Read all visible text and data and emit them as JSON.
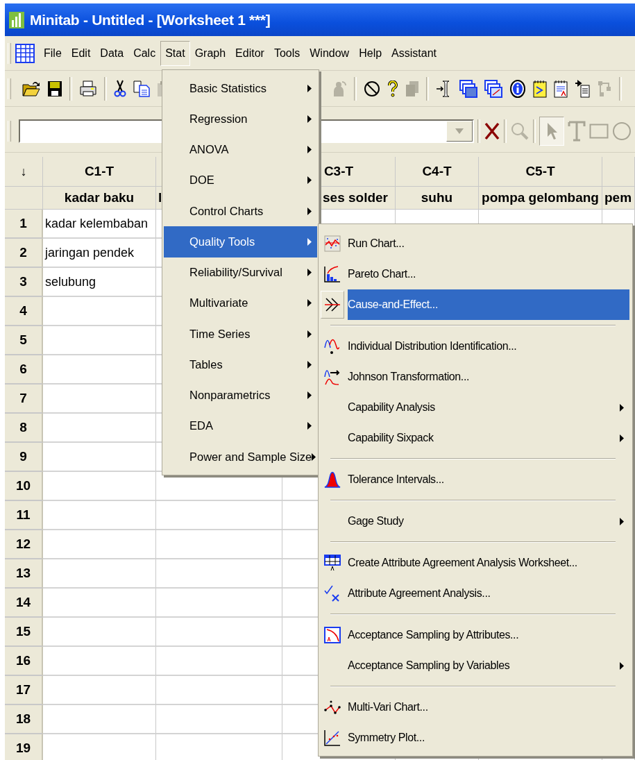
{
  "window": {
    "title": "Minitab - Untitled - [Worksheet 1 ***]"
  },
  "menubar": [
    {
      "label": "File",
      "selected": false
    },
    {
      "label": "Edit",
      "selected": false
    },
    {
      "label": "Data",
      "selected": false
    },
    {
      "label": "Calc",
      "selected": false
    },
    {
      "label": "Stat",
      "selected": true
    },
    {
      "label": "Graph",
      "selected": false
    },
    {
      "label": "Editor",
      "selected": false
    },
    {
      "label": "Tools",
      "selected": false
    },
    {
      "label": "Window",
      "selected": false
    },
    {
      "label": "Help",
      "selected": false
    },
    {
      "label": "Assistant",
      "selected": false
    }
  ],
  "worksheet": {
    "corner": "↓",
    "columns": [
      {
        "header": "C1-T",
        "name": "kadar baku"
      },
      {
        "name": "l"
      },
      {
        "header": "C3-T",
        "name": "ses solder"
      },
      {
        "header": "C4-T",
        "name": "suhu"
      },
      {
        "header": "C5-T",
        "name": "pompa gelombang"
      },
      {
        "name": "pem"
      }
    ],
    "rows": [
      {
        "number": "1",
        "cells": [
          "kadar kelembaban"
        ]
      },
      {
        "number": "2",
        "cells": [
          "jaringan pendek"
        ]
      },
      {
        "number": "3",
        "cells": [
          "selubung"
        ]
      },
      {
        "number": "4"
      },
      {
        "number": "5"
      },
      {
        "number": "6"
      },
      {
        "number": "7"
      },
      {
        "number": "8"
      },
      {
        "number": "9"
      },
      {
        "number": "10"
      },
      {
        "number": "11"
      },
      {
        "number": "12"
      },
      {
        "number": "13"
      },
      {
        "number": "14"
      },
      {
        "number": "15"
      },
      {
        "number": "16"
      },
      {
        "number": "17"
      },
      {
        "number": "18"
      },
      {
        "number": "19"
      }
    ]
  },
  "stat_menu": {
    "items": [
      {
        "label": "Basic Statistics",
        "submenu": true,
        "selected": false
      },
      {
        "label": "Regression",
        "submenu": true,
        "selected": false
      },
      {
        "label": "ANOVA",
        "submenu": true,
        "selected": false
      },
      {
        "label": "DOE",
        "submenu": true,
        "selected": false
      },
      {
        "label": "Control Charts",
        "submenu": true,
        "selected": false
      },
      {
        "label": "Quality Tools",
        "submenu": true,
        "selected": true
      },
      {
        "label": "Reliability/Survival",
        "submenu": true,
        "selected": false
      },
      {
        "label": "Multivariate",
        "submenu": true,
        "selected": false
      },
      {
        "label": "Time Series",
        "submenu": true,
        "selected": false
      },
      {
        "label": "Tables",
        "submenu": true,
        "selected": false
      },
      {
        "label": "Nonparametrics",
        "submenu": true,
        "selected": false
      },
      {
        "label": "EDA",
        "submenu": true,
        "selected": false
      },
      {
        "label": "Power and Sample Size",
        "submenu": true,
        "selected": false
      }
    ]
  },
  "quality_tools_menu": {
    "items": [
      {
        "kind": "item",
        "label": "Run Chart...",
        "submenu": false,
        "selected": false
      },
      {
        "kind": "item",
        "label": "Pareto Chart...",
        "submenu": false,
        "selected": false
      },
      {
        "kind": "item",
        "label": "Cause-and-Effect...",
        "submenu": false,
        "selected": true
      },
      {
        "kind": "separator"
      },
      {
        "kind": "item",
        "label": "Individual Distribution Identification...",
        "submenu": false,
        "selected": false
      },
      {
        "kind": "item",
        "label": "Johnson Transformation...",
        "submenu": false,
        "selected": false
      },
      {
        "kind": "item",
        "label": "Capability Analysis",
        "submenu": true,
        "selected": false
      },
      {
        "kind": "item",
        "label": "Capability Sixpack",
        "submenu": true,
        "selected": false
      },
      {
        "kind": "separator"
      },
      {
        "kind": "item",
        "label": "Tolerance Intervals...",
        "submenu": false,
        "selected": false
      },
      {
        "kind": "separator"
      },
      {
        "kind": "item",
        "label": "Gage Study",
        "submenu": true,
        "selected": false
      },
      {
        "kind": "separator"
      },
      {
        "kind": "item",
        "label": "Create Attribute Agreement Analysis Worksheet...",
        "submenu": false,
        "selected": false
      },
      {
        "kind": "item",
        "label": "Attribute Agreement Analysis...",
        "submenu": false,
        "selected": false
      },
      {
        "kind": "separator"
      },
      {
        "kind": "item",
        "label": "Acceptance Sampling by Attributes...",
        "submenu": false,
        "selected": false
      },
      {
        "kind": "item",
        "label": "Acceptance Sampling by Variables",
        "submenu": true,
        "selected": false
      },
      {
        "kind": "separator"
      },
      {
        "kind": "item",
        "label": "Multi-Vari Chart...",
        "submenu": false,
        "selected": false
      },
      {
        "kind": "item",
        "label": "Symmetry Plot...",
        "submenu": false,
        "selected": false
      }
    ]
  }
}
